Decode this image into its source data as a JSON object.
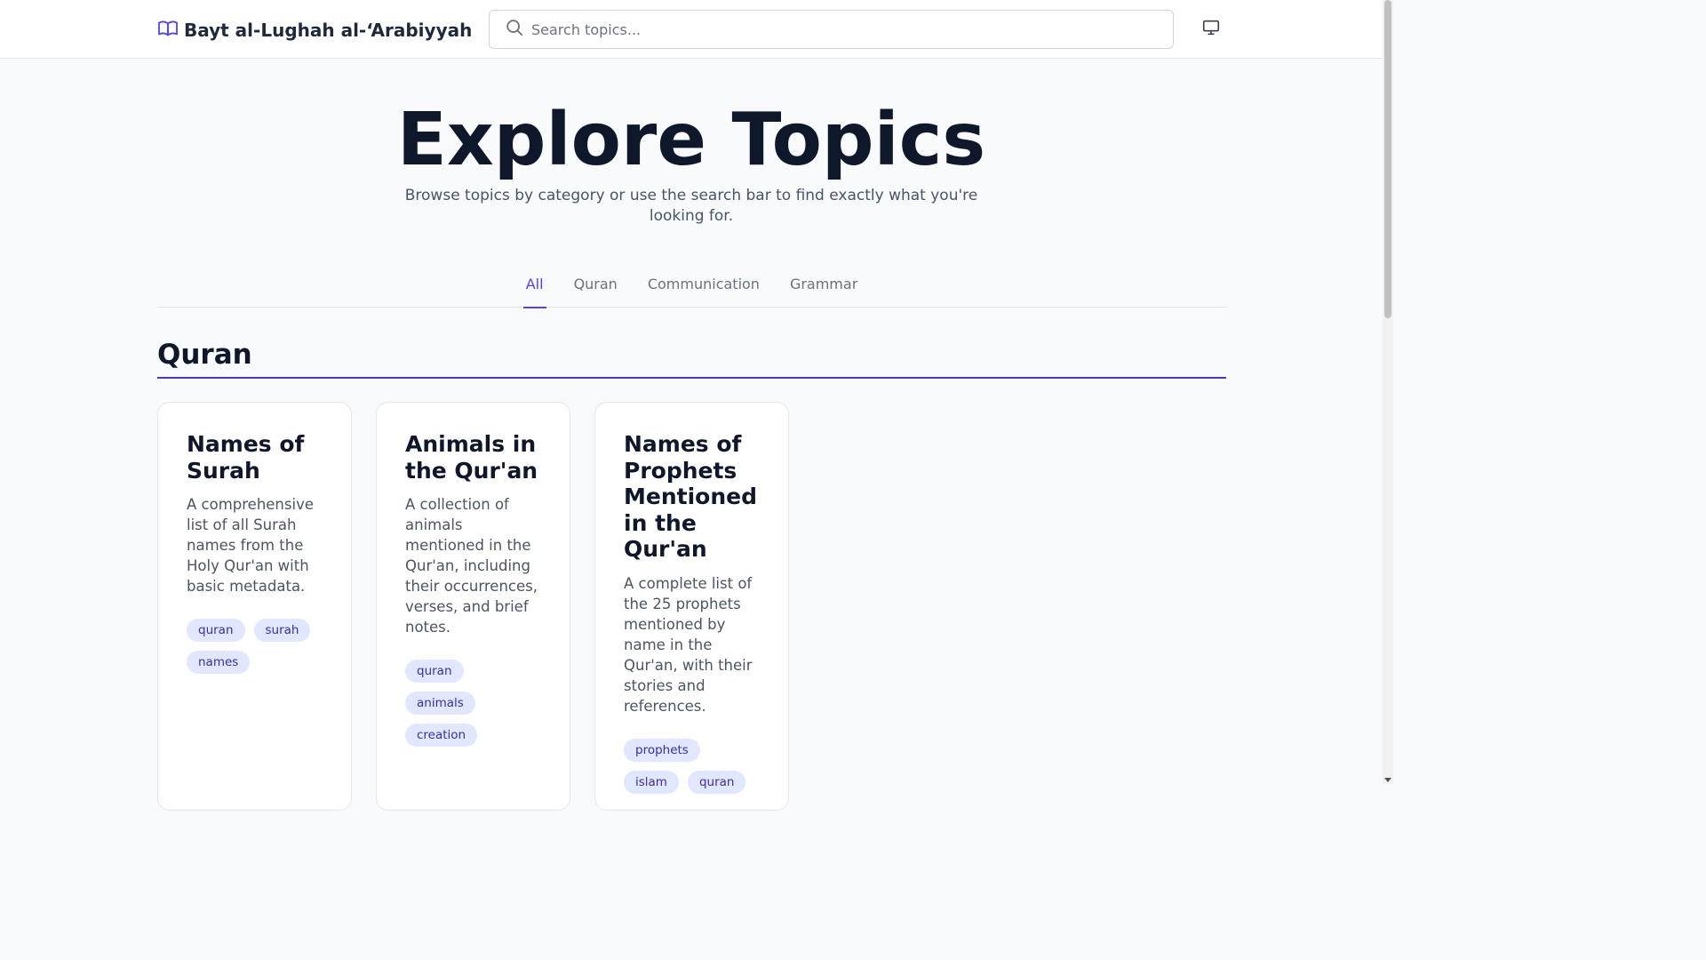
{
  "header": {
    "brand": "Bayt al-Lughah al-‘Arabiyyah",
    "brand_icon": "book-open-icon",
    "search_placeholder": "Search topics...",
    "display_icon": "monitor-icon"
  },
  "hero": {
    "title": "Explore Topics",
    "subtitle": "Browse topics by category or use the search bar to find exactly what you're looking for."
  },
  "tabs": [
    {
      "label": "All",
      "active": true
    },
    {
      "label": "Quran",
      "active": false
    },
    {
      "label": "Communication",
      "active": false
    },
    {
      "label": "Grammar",
      "active": false
    }
  ],
  "section": {
    "title": "Quran"
  },
  "cards": [
    {
      "title": "Names of Surah",
      "description": "A comprehensive list of all Surah names from the Holy Qur'an with basic metadata.",
      "tags": [
        "quran",
        "surah",
        "names"
      ]
    },
    {
      "title": "Animals in the Qur'an",
      "description": "A collection of animals mentioned in the Qur'an, including their occurrences, verses, and brief notes.",
      "tags": [
        "quran",
        "animals",
        "creation"
      ]
    },
    {
      "title": "Names of Prophets Mentioned in the Qur'an",
      "description": "A complete list of the 25 prophets mentioned by name in the Qur'an, with their stories and references.",
      "tags": [
        "prophets",
        "islam",
        "quran"
      ]
    }
  ],
  "colors": {
    "accent": "#4f46e5",
    "tag_bg": "#e0e7ff",
    "tag_text": "#3730a3"
  }
}
